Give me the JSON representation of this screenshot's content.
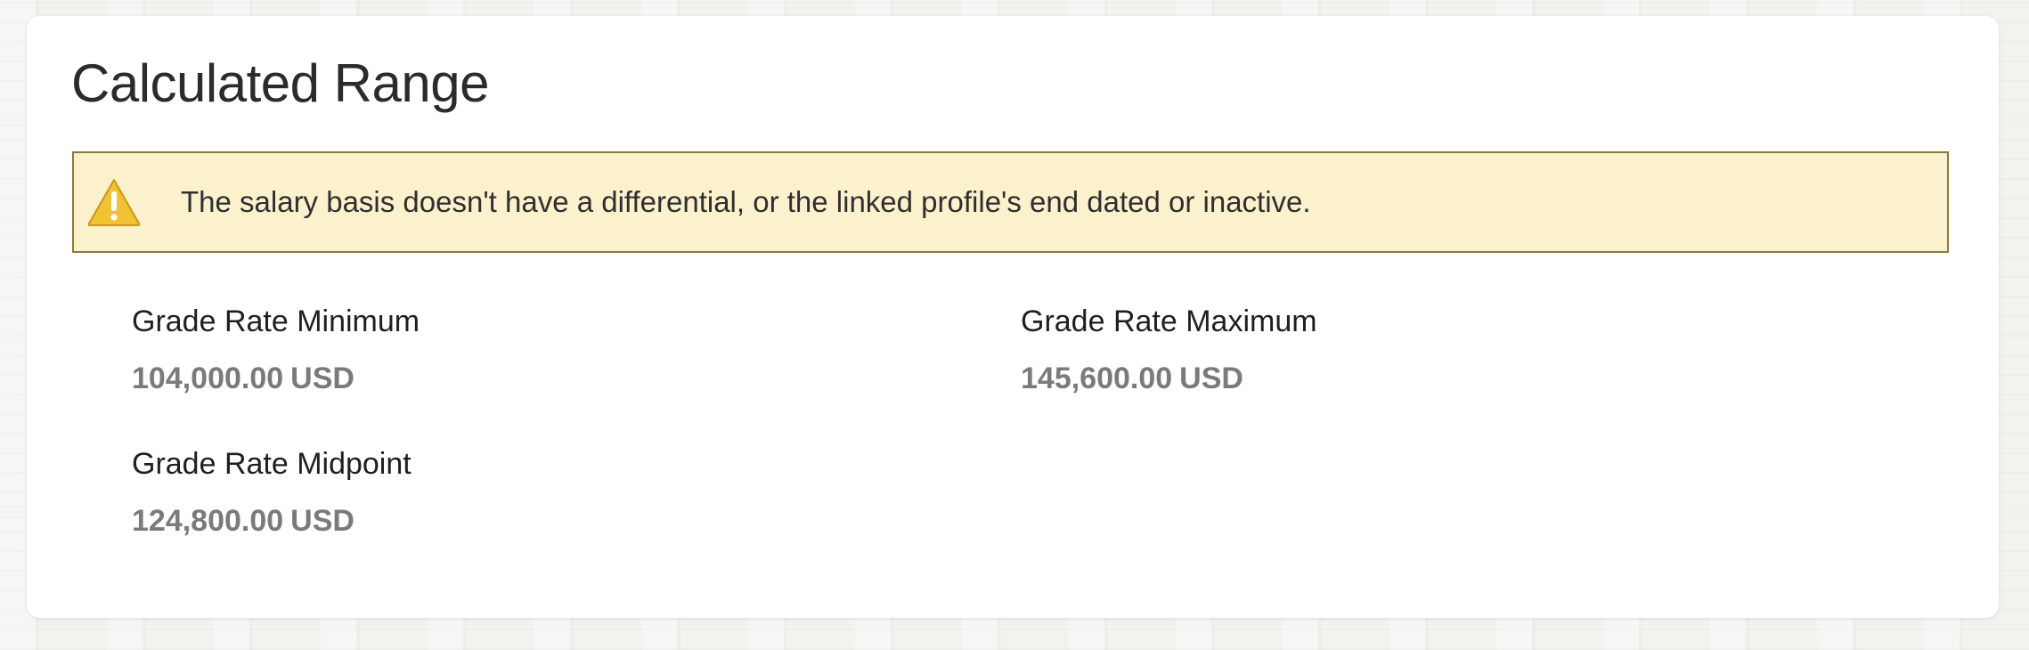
{
  "section": {
    "title": "Calculated Range"
  },
  "warning": {
    "icon": "warning-icon",
    "message": "The salary basis doesn't have a differential, or the linked profile's end dated or inactive.",
    "background_color": "#fbf1cd",
    "border_color": "#8a7a3a"
  },
  "fields": {
    "minimum": {
      "label": "Grade Rate Minimum",
      "amount": "104,000.00",
      "currency": "USD"
    },
    "maximum": {
      "label": "Grade Rate Maximum",
      "amount": "145,600.00",
      "currency": "USD"
    },
    "midpoint": {
      "label": "Grade Rate Midpoint",
      "amount": "124,800.00",
      "currency": "USD"
    }
  }
}
